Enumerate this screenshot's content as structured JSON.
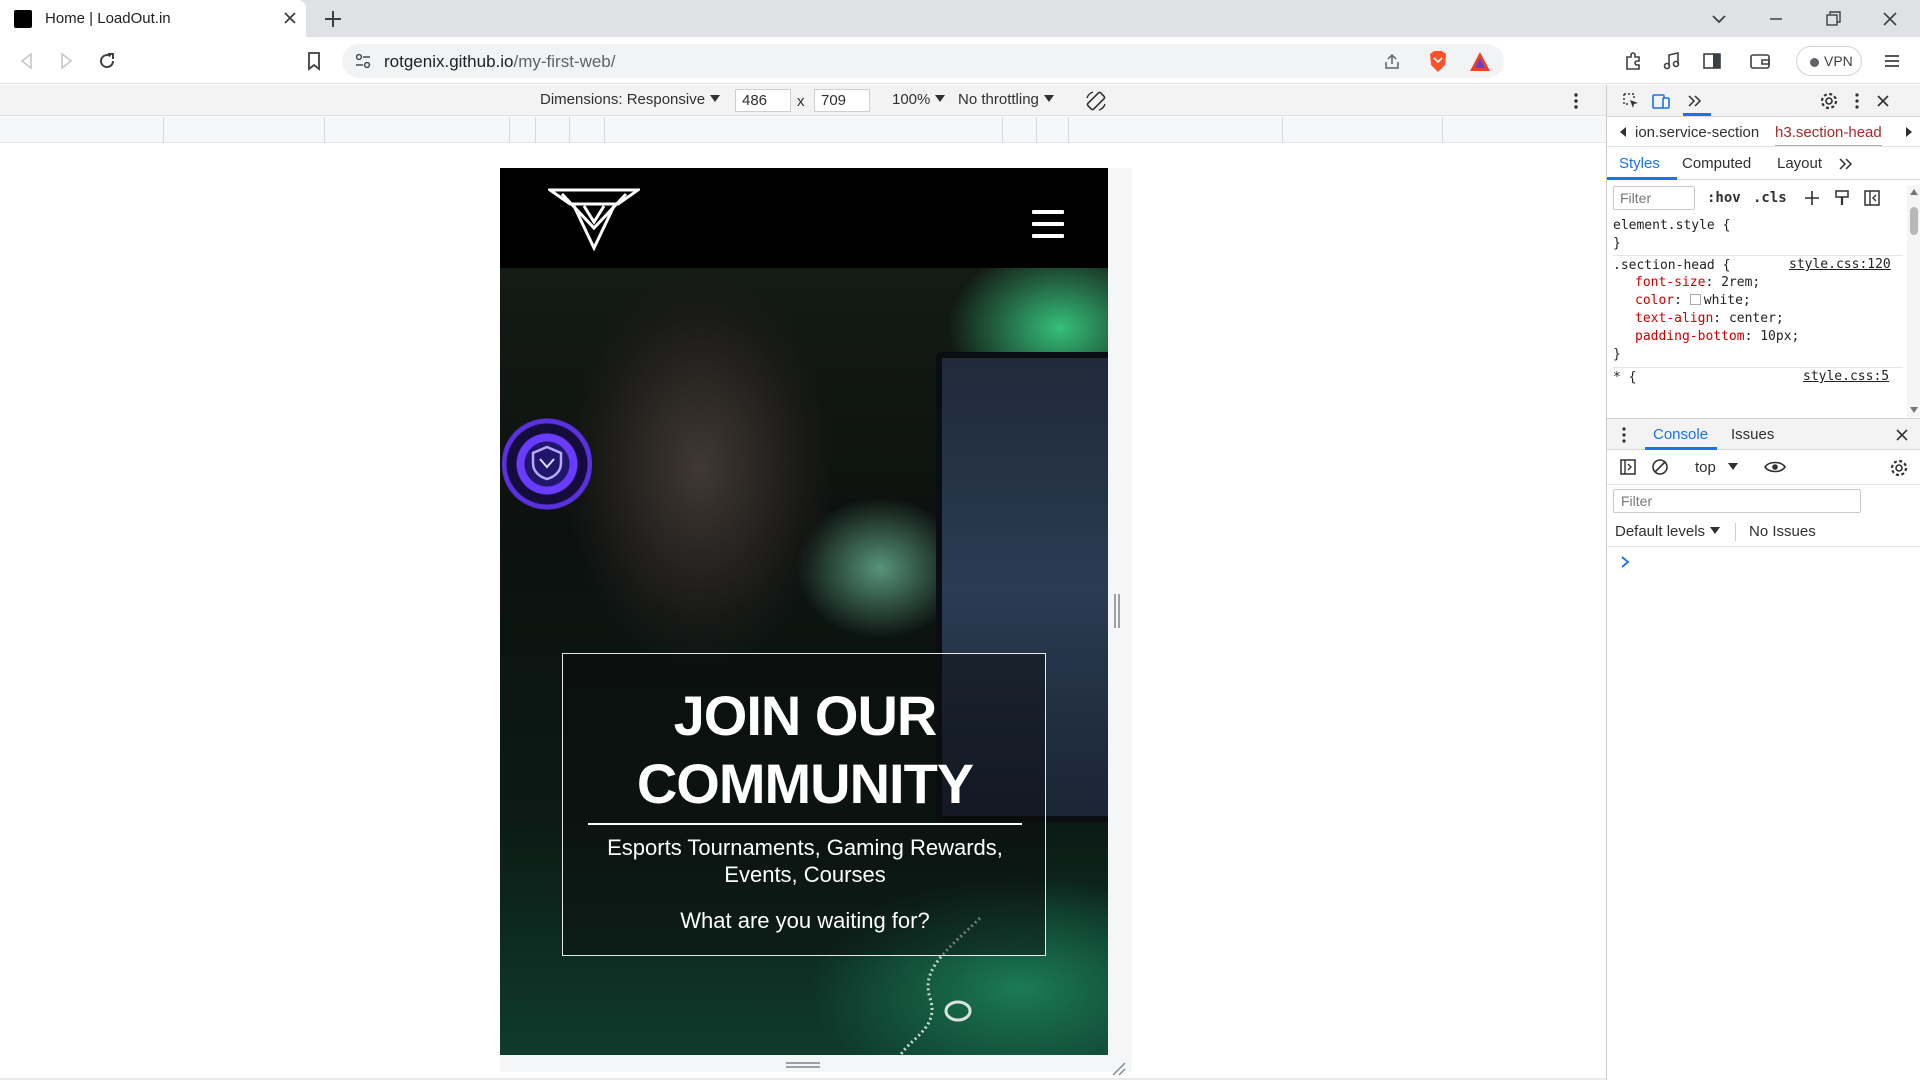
{
  "browser": {
    "tab_title": "Home | LoadOut.in",
    "url_host": "rotgenix.github.io",
    "url_path": "/my-first-web/",
    "vpn_label": "VPN"
  },
  "device_toolbar": {
    "dimensions_label": "Dimensions: Responsive",
    "width": "486",
    "times": "x",
    "height": "709",
    "zoom": "100%",
    "throttling": "No throttling"
  },
  "site": {
    "cta_heading": "JOIN OUR COMMUNITY",
    "cta_subtitle": "Esports Tournaments, Gaming Rewards, Events, Courses",
    "cta_question": "What are you waiting for?"
  },
  "devtools": {
    "breadcrumbs": [
      "ion.service-section",
      "h3.section-head"
    ],
    "panel_tabs": [
      "Styles",
      "Computed",
      "Layout"
    ],
    "styles_filter_placeholder": "Filter",
    "hov": ":hov",
    "cls": ".cls",
    "element_style_open": "element.style {",
    "close_brace": "}",
    "rule_selector": ".section-head {",
    "rule_source": "style.css:120",
    "rule_props": [
      {
        "name": "font-size",
        "value": "2rem;"
      },
      {
        "name": "color",
        "value": "white;"
      },
      {
        "name": "text-align",
        "value": "center;"
      },
      {
        "name": "padding-bottom",
        "value": "10px;"
      }
    ],
    "next_rule_partial": "* {",
    "next_rule_source_partial": "style.css:5",
    "console_tabs": [
      "Console",
      "Issues"
    ],
    "context": "top",
    "console_filter_placeholder": "Filter",
    "levels": "Default levels",
    "issues_status": "No Issues"
  },
  "colors": {
    "accent": "#1a73e8",
    "css_property": "#c80000",
    "brave_orange": "#fb542b",
    "site_bg": "#000000"
  }
}
